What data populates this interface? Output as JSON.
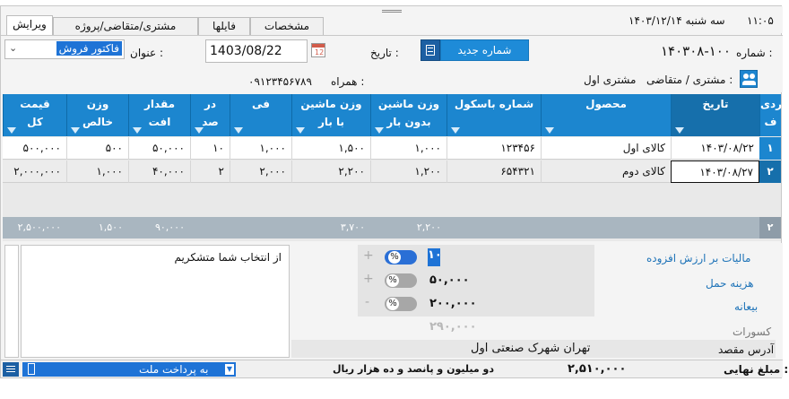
{
  "header": {
    "clock": "۱۱:۰۵",
    "date": "سه شنبه  ۱۴۰۳/۱۲/۱۴",
    "tabs": [
      {
        "label": "ویرایش"
      },
      {
        "label": "مشتری/متقاضی/پروژه"
      },
      {
        "label": "فایلها"
      },
      {
        "label": "مشخصات"
      }
    ]
  },
  "form": {
    "number_label": "شماره :",
    "number_value": "۱۴۰۳۰۸-۱۰۰",
    "new_number_button": "شماره جدید",
    "date_label": "تاریخ :",
    "date_value": "1403/08/22",
    "title_label": "عنوان :",
    "title_value": "فاکتور فروش",
    "customer_label": "مشتری / متقاضی :",
    "customer_value": "مشتری اول",
    "mobile_label": "همراه :",
    "mobile_value": "۰۹۱۲۳۴۵۶۷۸۹"
  },
  "grid": {
    "columns": [
      "ردیف",
      "تاریخ",
      "محصول",
      "شماره باسکول",
      "وزن ماشین بدون بار",
      "وزن ماشین با بار",
      "فی",
      "در صد",
      "مقدار افت",
      "وزن خالص",
      "قیمت کل"
    ],
    "headers": {
      "row": [
        "ردی",
        "ف"
      ],
      "date": [
        "تاریخ",
        ""
      ],
      "product": [
        "محصول",
        ""
      ],
      "scale": [
        "شماره باسکول",
        ""
      ],
      "empty_weight": [
        "وزن ماشین",
        "بدون بار"
      ],
      "loaded_weight": [
        "وزن ماشین",
        "با بار"
      ],
      "fee": [
        "فی",
        ""
      ],
      "percent": [
        "در",
        "صد"
      ],
      "drop": [
        "مقدار",
        "افت"
      ],
      "net": [
        "وزن",
        "خالص"
      ],
      "total": [
        "قیمت",
        "کل"
      ]
    },
    "rows": [
      {
        "no": "۱",
        "date": "۱۴۰۳/۰۸/۲۲",
        "product": "کالای اول",
        "scale": "۱۲۳۴۵۶",
        "empty_weight": "۱,۰۰۰",
        "loaded_weight": "۱,۵۰۰",
        "fee": "۱,۰۰۰",
        "percent": "۱۰",
        "drop": "۵۰,۰۰۰",
        "net": "۵۰۰",
        "total": "۵۰۰,۰۰۰"
      },
      {
        "no": "۲",
        "date": "۱۴۰۳/۰۸/۲۷",
        "product": "کالای دوم",
        "scale": "۶۵۴۳۲۱",
        "empty_weight": "۱,۲۰۰",
        "loaded_weight": "۲,۲۰۰",
        "fee": "۲,۰۰۰",
        "percent": "۲",
        "drop": "۴۰,۰۰۰",
        "net": "۱,۰۰۰",
        "total": "۲,۰۰۰,۰۰۰"
      }
    ],
    "totals": {
      "count": "۲",
      "empty_weight": "۲,۲۰۰",
      "loaded_weight": "۳,۷۰۰",
      "drop": "۹۰,۰۰۰",
      "net": "۱,۵۰۰",
      "total": "۲,۵۰۰,۰۰۰"
    }
  },
  "summary": {
    "notes": "از انتخاب شما متشکریم",
    "vat_label": "مالیات بر ارزش افزوده",
    "vat_value": "۱۰",
    "shipping_label": "هزینه حمل",
    "shipping_value": "۵۰,۰۰۰",
    "deposit_label": "بیعانه",
    "deposit_value": "۲۰۰,۰۰۰",
    "deductions_label": "کسورات",
    "deductions_value": "۲۹۰,۰۰۰",
    "address_label": "آدرس مقصد",
    "address_value": "تهران شهرک صنعتی اول",
    "toggle_symbol": "%",
    "plus_symbol": "+",
    "minus_symbol": "-"
  },
  "footer": {
    "final_label": "مبلغ نهایی :",
    "final_value": "۲,۵۱۰,۰۰۰",
    "final_words": "دو میلیون و پانصد و ده هزار  ریال",
    "payment_option": "به پرداخت ملت"
  },
  "colors": {
    "header_blue": "#1c86cf",
    "button_blue": "#1e8bd8",
    "total_bar": "#a9b6c0",
    "label_blue": "#1e73b8",
    "toggle_on": "#2a6fd6"
  }
}
